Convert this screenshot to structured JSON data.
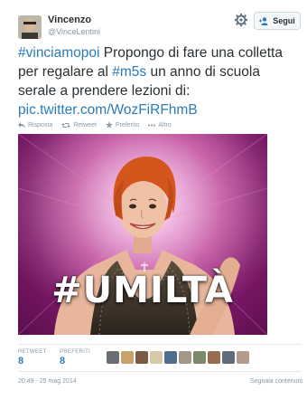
{
  "user": {
    "name": "Vincenzo",
    "handle": "@VinceLentini"
  },
  "follow_button": {
    "label": "Segui"
  },
  "tweet": {
    "parts": [
      {
        "text": "#vinciamopoi",
        "link": true
      },
      {
        "text": " Propongo di fare una colletta per regalare al ",
        "link": false
      },
      {
        "text": "#m5s",
        "link": true
      },
      {
        "text": " un anno di scuola serale a prendere lezioni di: ",
        "link": false
      },
      {
        "text": "pic.twitter.com/WozFiRFhmB",
        "link": true
      }
    ]
  },
  "actions": {
    "reply": "Risposta",
    "retweet": "Retweet",
    "favorite": "Preferito",
    "more": "Altro"
  },
  "media": {
    "overlay_text": "#UMILTÀ"
  },
  "stats": {
    "retweet_label": "RETWEET",
    "retweet_count": "8",
    "favorites_label": "PREFERITI",
    "favorites_count": "8"
  },
  "favoriters": {
    "count": 10,
    "colors": [
      "#6b6f73",
      "#c8a26b",
      "#7a5b43",
      "#d7c9a8",
      "#4f6e8c",
      "#a39886",
      "#7c8a6a",
      "#9a6c4f",
      "#5f6c7a",
      "#b49a8a"
    ]
  },
  "footer": {
    "timestamp": "20:49 - 25 mag 2014",
    "report": "Segnala contenuto"
  },
  "colors": {
    "link": "#2b7bb9",
    "muted": "#8899a6",
    "text": "#292f33",
    "media_bg": "#b8368f"
  }
}
